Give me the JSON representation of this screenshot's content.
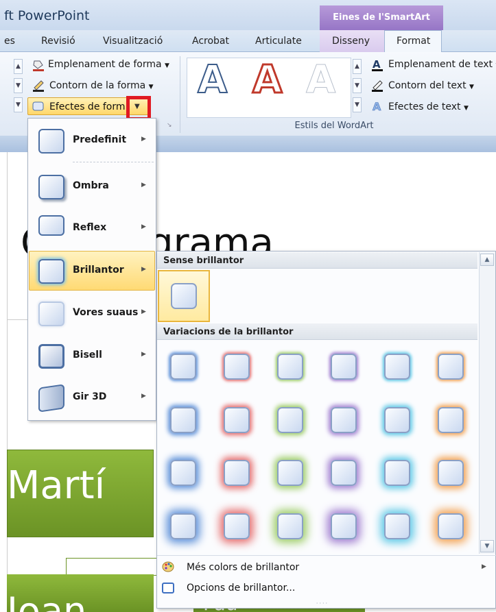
{
  "app": {
    "title": "ft PowerPoint"
  },
  "context_tab": {
    "title": "Eines de l'SmartArt"
  },
  "tabs": [
    {
      "label": "es"
    },
    {
      "label": "Revisió"
    },
    {
      "label": "Visualització"
    },
    {
      "label": "Acrobat"
    },
    {
      "label": "Articulate"
    },
    {
      "label": "Disseny"
    },
    {
      "label": "Format"
    }
  ],
  "ribbon": {
    "shape_fill": "Emplenament de forma",
    "shape_outline": "Contorn de la forma",
    "shape_effects": "Efectes de form",
    "wordart_group": "Estils del WordArt",
    "wordart_letter": "A",
    "text_fill": "Emplenament de text",
    "text_outline": "Contorn del text",
    "text_effects": "Efectes de text"
  },
  "slide": {
    "title": "Organigrama",
    "green_text": "Martí",
    "green_text2": "Joan",
    "bottom_text": "Pau"
  },
  "effects_menu": {
    "items": [
      {
        "label": "Predefinit"
      },
      {
        "label": "Ombra"
      },
      {
        "label": "Reflex"
      },
      {
        "label": "Brillantor"
      },
      {
        "label": "Vores suaus"
      },
      {
        "label": "Bisell"
      },
      {
        "label": "Gir 3D"
      }
    ]
  },
  "glow_menu": {
    "no_glow_header": "Sense brillantor",
    "variations_header": "Variacions de la brillantor",
    "glow_colors": [
      "#5b8fd8",
      "#e56a6a",
      "#9ccc65",
      "#a07ed0",
      "#5cc8e6",
      "#f2a150"
    ],
    "more_colors": "Més colors de brillantor",
    "options": "Opcions de brillantor..."
  },
  "colors": {
    "accent_red": "#e01a22",
    "highlight": "#ffd76a",
    "green": "#7aa82e"
  }
}
